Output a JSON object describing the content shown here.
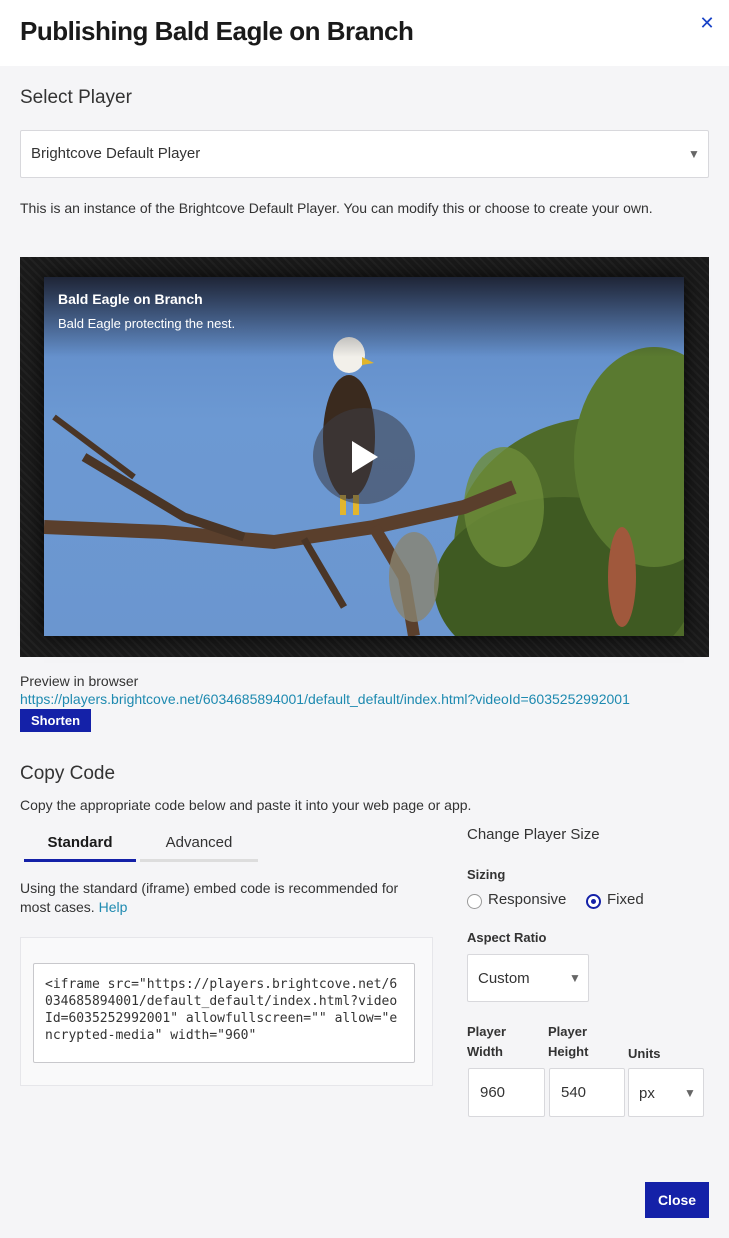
{
  "dialog": {
    "title": "Publishing Bald Eagle on Branch",
    "close_icon": "close-icon"
  },
  "select_player": {
    "heading": "Select Player",
    "selected": "Brightcove Default Player",
    "description": "This is an instance of the Brightcove Default Player. You can modify this or choose to create your own."
  },
  "video": {
    "title": "Bald Eagle on Branch",
    "description": "Bald Eagle protecting the nest."
  },
  "preview": {
    "label": "Preview in browser",
    "url": "https://players.brightcove.net/6034685894001/default_default/index.html?videoId=6035252992001",
    "shorten_label": "Shorten"
  },
  "copy_code": {
    "heading": "Copy Code",
    "description": "Copy the appropriate code below and paste it into your web page or app.",
    "tabs": [
      "Standard",
      "Advanced"
    ],
    "active_tab": "Standard",
    "note": "Using the standard (iframe) embed code is recommended for most cases.",
    "help_label": "Help",
    "code": "<iframe src=\"https://players.brightcove.net/6034685894001/default_default/index.html?videoId=6035252992001\" allowfullscreen=\"\" allow=\"encrypted-media\" width=\"960\""
  },
  "player_size": {
    "heading": "Change Player Size",
    "sizing_label": "Sizing",
    "sizing_options": [
      "Responsive",
      "Fixed"
    ],
    "sizing_selected": "Fixed",
    "aspect_label": "Aspect Ratio",
    "aspect_value": "Custom",
    "width_label_1": "Player",
    "width_label_2": "Width",
    "height_label_1": "Player",
    "height_label_2": "Height",
    "units_label": "Units",
    "width_value": "960",
    "height_value": "540",
    "units_value": "px"
  },
  "footer": {
    "close_label": "Close"
  },
  "colors": {
    "accent": "#1421a8",
    "link": "#1e8ab0"
  }
}
